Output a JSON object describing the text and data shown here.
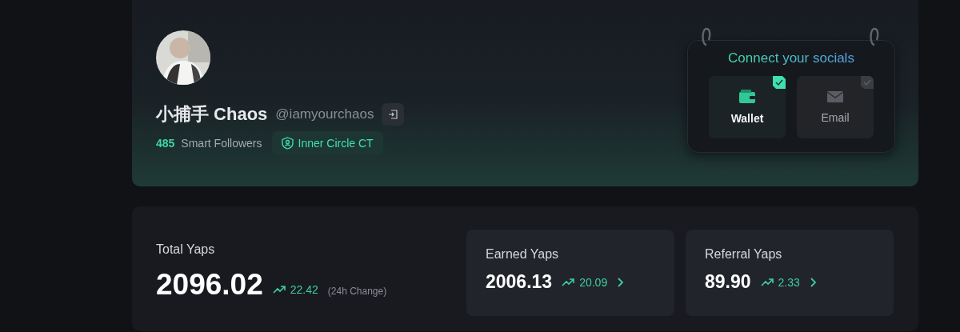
{
  "profile": {
    "name": "小捕手 Chaos",
    "handle": "@iamyourchaos",
    "followers_count": "485",
    "followers_label": "Smart Followers",
    "badge": "Inner Circle CT"
  },
  "socials": {
    "title": "Connect your socials",
    "items": [
      {
        "kind": "wallet",
        "label": "Wallet",
        "connected": true
      },
      {
        "kind": "email",
        "label": "Email",
        "connected": false
      }
    ]
  },
  "total": {
    "label": "Total Yaps",
    "value": "2096.02",
    "change": "22.42",
    "change_note": "(24h Change)"
  },
  "breakdown": [
    {
      "label": "Earned Yaps",
      "value": "2006.13",
      "change": "20.09"
    },
    {
      "label": "Referral Yaps",
      "value": "89.90",
      "change": "2.33"
    }
  ]
}
